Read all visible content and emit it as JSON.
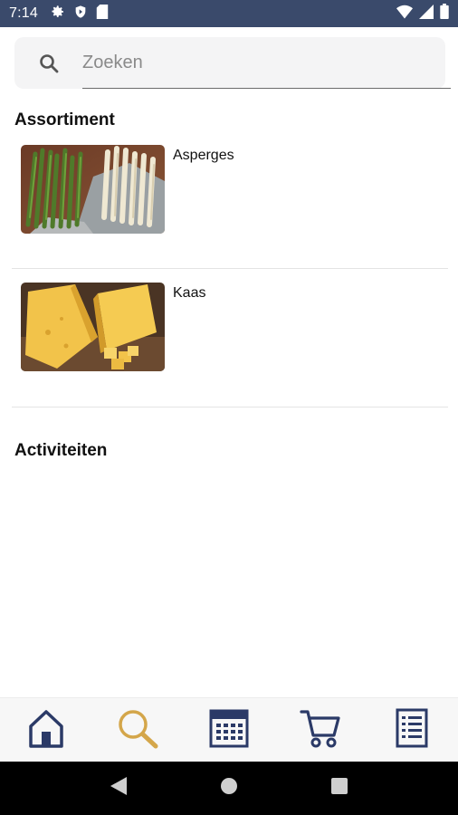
{
  "status_bar": {
    "time": "7:14",
    "left_icons": [
      "gear-icon",
      "shield-icon",
      "sim-card-icon"
    ],
    "right_icons": [
      "wifi-icon",
      "signal-icon",
      "battery-icon"
    ],
    "bg_color": "#3a4a6b"
  },
  "search": {
    "placeholder": "Zoeken",
    "value": "",
    "icon": "search-icon"
  },
  "sections": {
    "assortiment_title": "Assortiment",
    "activiteiten_title": "Activiteiten"
  },
  "products": [
    {
      "name": "Asperges",
      "image": "asparagus-image"
    },
    {
      "name": "Kaas",
      "image": "cheese-image"
    }
  ],
  "bottom_nav": {
    "items": [
      "home-icon",
      "search-icon",
      "calendar-icon",
      "cart-icon",
      "list-icon"
    ],
    "active": "search-icon",
    "active_color": "#d4a64a",
    "icon_color": "#2b3a67"
  },
  "system_nav": [
    "back-icon",
    "home-circle-icon",
    "recents-icon"
  ]
}
